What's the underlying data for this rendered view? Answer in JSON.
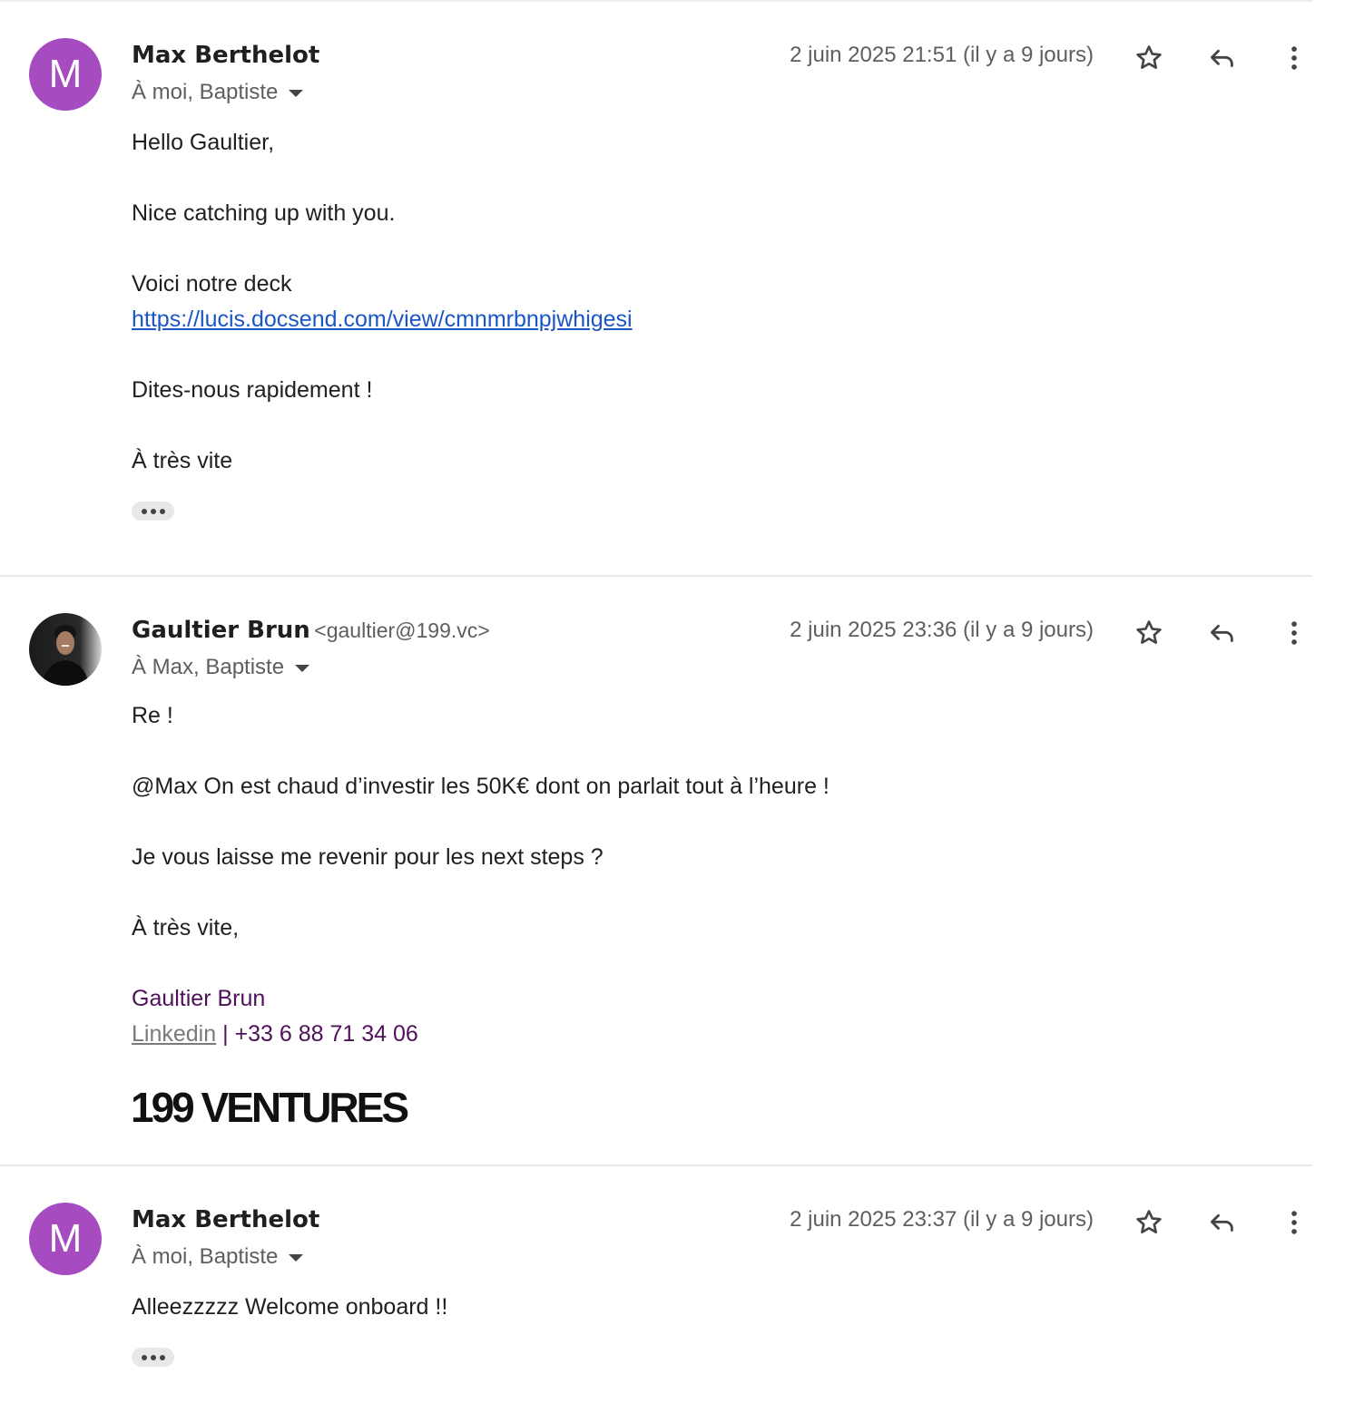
{
  "messages": [
    {
      "avatar_letter": "M",
      "avatar_color": "#a64cc0",
      "sender_name": "Max Berthelot",
      "recipients": "À moi, Baptiste",
      "date": "2 juin 2025 21:51 (il y a 9 jours)",
      "body": {
        "greeting": "Hello Gaultier,",
        "line1": "Nice catching up with you.",
        "line2": "Voici notre deck",
        "link": "https://lucis.docsend.com/view/cmnmrbnpjwhigesi",
        "line3": "Dites-nous rapidement !",
        "closing": "À très vite"
      }
    },
    {
      "avatar_icon": "profile-photo",
      "sender_name": "Gaultier Brun",
      "sender_email": "<gaultier@199.vc>",
      "recipients": "À Max, Baptiste",
      "date": "2 juin 2025 23:36 (il y a 9 jours)",
      "body": {
        "greeting": "Re !",
        "line1": "@Max On est chaud d’investir les 50K€ dont on parlait tout à l’heure !",
        "line2": "Je vous laisse me revenir pour les next steps ?",
        "closing": "À très vite,"
      },
      "signature": {
        "name": "Gaultier Brun",
        "linkedin": "Linkedin",
        "separator": " | ",
        "phone": "+33 6 88 71 34 06",
        "logo": "199 VENTURES"
      }
    },
    {
      "avatar_letter": "M",
      "avatar_color": "#a64cc0",
      "sender_name": "Max Berthelot",
      "recipients": "À moi, Baptiste",
      "date": "2 juin 2025 23:37 (il y a 9 jours)",
      "body": {
        "line1": "Alleezzzzz Welcome onboard !!"
      }
    }
  ],
  "icons": {
    "star": "star-outline-icon",
    "reply": "reply-arrow-icon",
    "more": "more-vert-icon",
    "expand": "three-dots-icon",
    "caret": "caret-down-icon"
  },
  "colors": {
    "avatar_purple": "#a64cc0",
    "link_blue": "#1a56c6",
    "signature_purple": "#50105a",
    "muted_text": "#5e5e5e"
  }
}
